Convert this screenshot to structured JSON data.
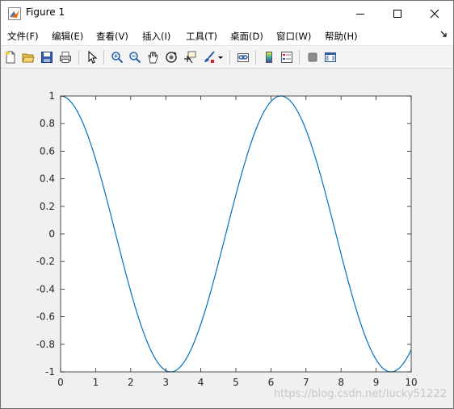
{
  "window": {
    "title": "Figure 1"
  },
  "menubar": {
    "items": [
      {
        "label": "文件(F)"
      },
      {
        "label": "编辑(E)"
      },
      {
        "label": "查看(V)"
      },
      {
        "label": "插入(I)"
      },
      {
        "label": "工具(T)"
      },
      {
        "label": "桌面(D)"
      },
      {
        "label": "窗口(W)"
      },
      {
        "label": "帮助(H)"
      }
    ],
    "overflow_icon": "dock-arrow-icon"
  },
  "toolbar": {
    "buttons": [
      "new-figure-icon",
      "open-file-icon",
      "save-icon",
      "print-icon",
      "edit-plot-arrow-icon",
      "zoom-in-icon",
      "zoom-out-icon",
      "pan-hand-icon",
      "rotate-3d-icon",
      "data-cursor-icon",
      "brush-icon",
      "brush-dropdown-icon",
      "link-plot-icon",
      "colorbar-icon",
      "legend-icon",
      "hide-plot-tools-icon",
      "show-plot-tools-icon"
    ]
  },
  "chart_data": {
    "type": "line",
    "title": "",
    "xlabel": "",
    "ylabel": "",
    "xlim": [
      0,
      10
    ],
    "ylim": [
      -1,
      1
    ],
    "xticks": [
      "0",
      "1",
      "2",
      "3",
      "4",
      "5",
      "6",
      "7",
      "8",
      "9",
      "10"
    ],
    "yticks": [
      "1",
      "0.8",
      "0.6",
      "0.4",
      "0.2",
      "0",
      "-0.2",
      "-0.4",
      "-0.6",
      "-0.8",
      "-1"
    ],
    "grid": false,
    "series": [
      {
        "function": "cos(x)",
        "color": "#0072bd",
        "x": [
          0,
          0.5,
          1,
          1.5,
          2,
          2.5,
          3,
          3.14,
          3.5,
          4,
          4.5,
          5,
          5.5,
          6,
          6.28,
          6.5,
          7,
          7.5,
          8,
          8.5,
          9,
          9.42,
          9.5,
          10
        ],
        "y": [
          1,
          0.878,
          0.54,
          0.071,
          -0.416,
          -0.801,
          -0.99,
          -1,
          -0.936,
          -0.654,
          -0.211,
          0.284,
          0.709,
          0.96,
          1,
          0.977,
          0.754,
          0.347,
          -0.146,
          -0.602,
          -0.911,
          -1,
          -0.997,
          -0.839
        ]
      }
    ]
  },
  "watermark": "https://blog.csdn.net/lucky51222"
}
